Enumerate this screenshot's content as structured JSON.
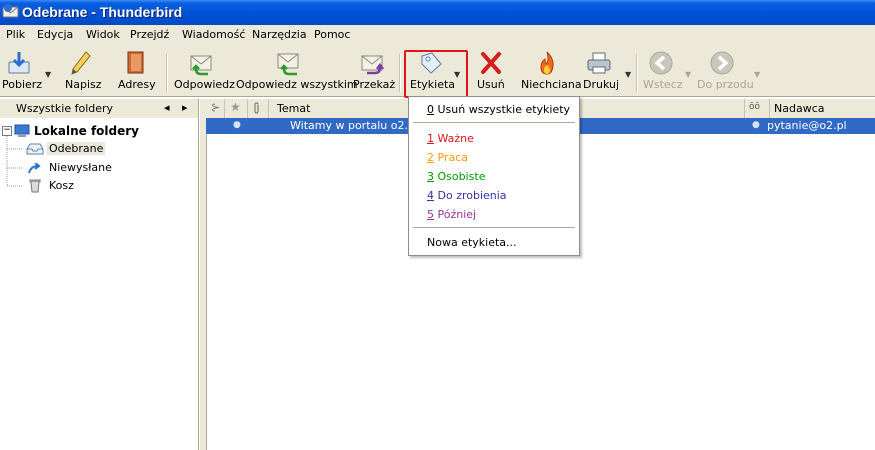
{
  "window": {
    "title": "Odebrane - Thunderbird"
  },
  "menu_bar": {
    "items": [
      {
        "label": "Plik"
      },
      {
        "label": "Edycja"
      },
      {
        "label": "Widok"
      },
      {
        "label": "Przejdź"
      },
      {
        "label": "Wiadomość"
      },
      {
        "label": "Narzędzia"
      },
      {
        "label": "Pomoc"
      }
    ]
  },
  "toolbar": {
    "get_mail": "Pobierz",
    "write": "Napisz",
    "address_book": "Adresy",
    "reply": "Odpowiedz",
    "reply_all": "Odpowiedz wszystkim",
    "forward": "Przekaż",
    "tag": "Etykieta",
    "delete": "Usuń",
    "junk": "Niechciana",
    "print": "Drukuj",
    "back": "Wstecz",
    "forward_nav": "Do przodu"
  },
  "folder_pane": {
    "header": "Wszystkie foldery",
    "nav_left": "◂",
    "nav_right": "▸",
    "root": "Lokalne foldery",
    "expander": "−",
    "folders": [
      {
        "label": "Odebrane"
      },
      {
        "label": "Niewysłane"
      },
      {
        "label": "Kosz"
      }
    ]
  },
  "message_list": {
    "columns": {
      "subject": "Temat",
      "sender": "Nadawca"
    },
    "rows": [
      {
        "subject": "Witamy w portalu o2.pl",
        "sender": "pytanie@o2.pl"
      }
    ]
  },
  "tag_menu": {
    "remove_all": {
      "num": "0",
      "label": " Usuń wszystkie etykiety"
    },
    "tags": [
      {
        "num": "1",
        "label": " Ważne",
        "color": "#e0151b"
      },
      {
        "num": "2",
        "label": " Praca",
        "color": "#ff9900"
      },
      {
        "num": "3",
        "label": " Osobiste",
        "color": "#009900"
      },
      {
        "num": "4",
        "label": " Do zrobienia",
        "color": "#3333aa"
      },
      {
        "num": "5",
        "label": " Później",
        "color": "#993399"
      }
    ],
    "new_tag": "Nowa etykieta..."
  },
  "colors": {
    "titlebar": "#0053d8",
    "chrome": "#ece9d8",
    "selection": "#316ac5",
    "highlight_box": "#e0151b"
  }
}
